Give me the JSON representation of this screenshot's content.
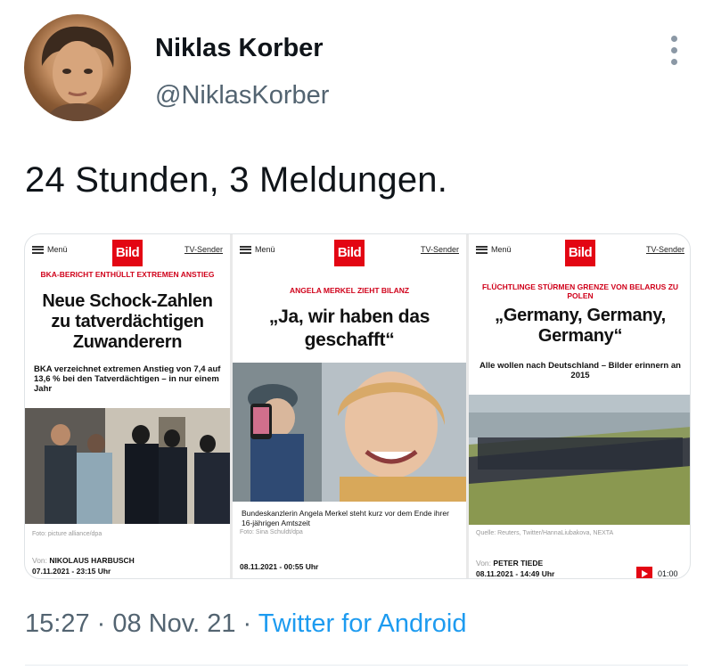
{
  "tweet": {
    "author_name": "Niklas Korber",
    "author_handle": "@NiklasKorber",
    "text": "24 Stunden, 3 Meldungen.",
    "time": "15:27",
    "separator": "·",
    "date": "08 Nov. 21",
    "client": "Twitter for Android"
  },
  "icons": {
    "avatar": "person-avatar",
    "more": "more-vertical-icon",
    "menu": "hamburger-icon",
    "play": "play-icon"
  },
  "colors": {
    "link": "#1d9bf0",
    "muted": "#536471",
    "bild_red": "#e30613"
  },
  "cards": [
    {
      "menu_label": "Menü",
      "logo": "Bild",
      "tv_label": "TV-Sender",
      "kicker": "BKA-BERICHT ENTHÜLLT EXTREMEN ANSTIEG",
      "headline": "Neue Schock-Zahlen zu tatverdächtigen Zuwanderern",
      "teaser": "BKA verzeichnet extremen Anstieg von 7,4 auf 13,6 % bei den Tatverdächtigen – in nur einem Jahr",
      "caption": "Foto: picture alliance/dpa",
      "author_prefix": "Von:",
      "author": "NIKOLAUS HARBUSCH",
      "date": "07.11.2021 - 23:15 Uhr"
    },
    {
      "menu_label": "Menü",
      "logo": "Bild",
      "tv_label": "TV-Sender",
      "kicker": "ANGELA MERKEL ZIEHT BILANZ",
      "headline": "„Ja, wir haben das geschafft“",
      "teaser": "Bundeskanzlerin Angela Merkel steht kurz vor dem Ende ihrer 16-jährigen Amtszeit",
      "caption": "Foto: Sina Schuldt/dpa",
      "date": "08.11.2021 - 00:55 Uhr"
    },
    {
      "menu_label": "Menü",
      "logo": "Bild",
      "tv_label": "TV-Sender",
      "kicker": "FLÜCHTLINGE STÜRMEN GRENZE VON BELARUS ZU POLEN",
      "headline": "„Germany, Germany, Germany“",
      "teaser": "Alle wollen nach Deutschland – Bilder erinnern an 2015",
      "video_time": "01:00",
      "caption": "Quelle: Reuters, Twitter/HannaLiubakova, NEXTA",
      "author_prefix": "Von:",
      "author": "PETER TIEDE",
      "date": "08.11.2021 - 14:49 Uhr"
    }
  ]
}
